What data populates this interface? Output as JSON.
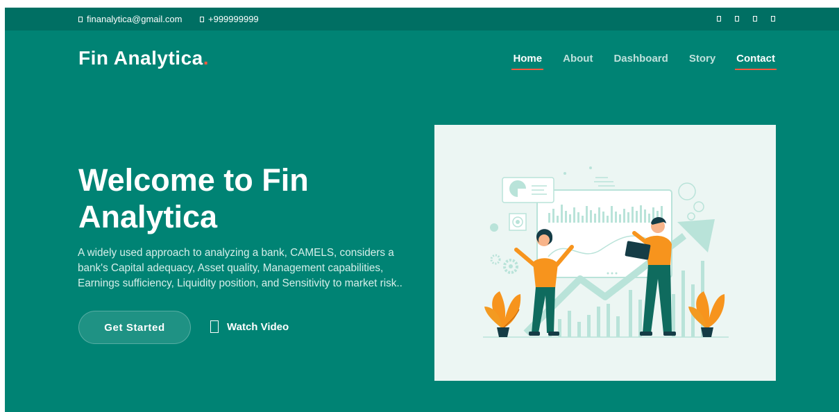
{
  "topbar": {
    "email": "finanalytica@gmail.com",
    "phone": "+999999999",
    "social_icons": [
      "twitter-icon",
      "facebook-icon",
      "instagram-icon",
      "linkedin-icon"
    ]
  },
  "brand": {
    "name": "Fin Analytica",
    "dot": "."
  },
  "nav": {
    "items": [
      {
        "label": "Home",
        "active": true
      },
      {
        "label": "About",
        "active": false
      },
      {
        "label": "Dashboard",
        "active": false
      },
      {
        "label": "Story",
        "active": false
      },
      {
        "label": "Contact",
        "active": true
      }
    ]
  },
  "hero": {
    "title": "Welcome to Fin Analytica",
    "description": "A widely used approach to analyzing a bank, CAMELS, considers a bank's Capital adequacy, Asset quality, Management capabilities, Earnings sufficiency, Liquidity position, and Sensitivity to market risk..",
    "cta_label": "Get Started",
    "watch_label": "Watch Video"
  },
  "colors": {
    "background": "#008374",
    "topbar": "#006f63",
    "accent": "#f85a40",
    "illustration_bg": "#ecf6f3",
    "illustration_orange": "#f7941d",
    "illustration_teal": "#0f6b5e"
  }
}
